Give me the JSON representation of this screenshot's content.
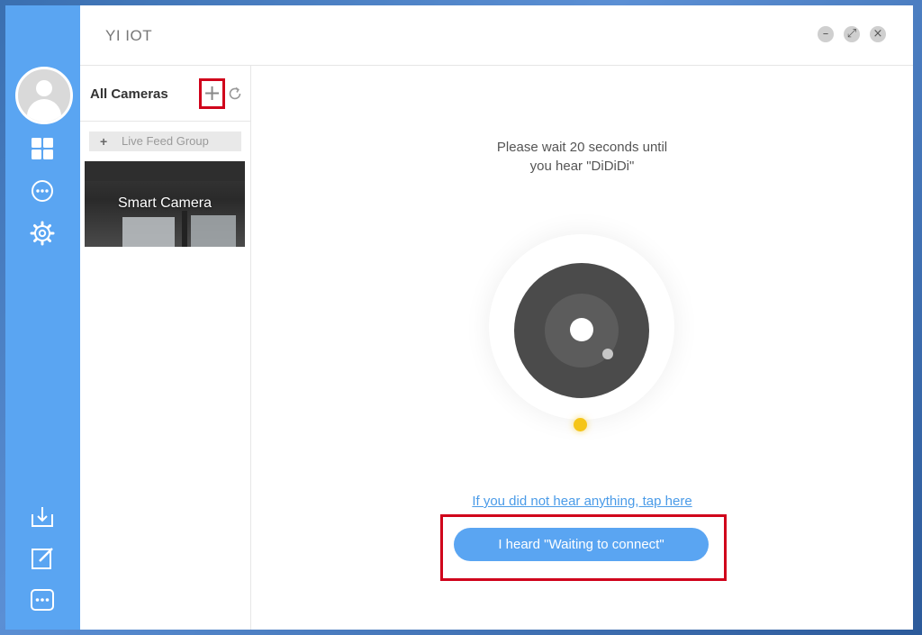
{
  "app": {
    "title": "YI IOT"
  },
  "window_controls": {
    "minimize": "–",
    "restore": "⤢",
    "close": "×"
  },
  "nav_rail": {
    "top_items": [
      {
        "name": "dashboard",
        "icon": "grid-icon"
      },
      {
        "name": "messages",
        "icon": "chat-bubble-icon"
      },
      {
        "name": "settings",
        "icon": "gear-icon"
      }
    ],
    "bottom_items": [
      {
        "name": "download",
        "icon": "download-icon"
      },
      {
        "name": "feedback",
        "icon": "edit-icon"
      },
      {
        "name": "more",
        "icon": "more-icon"
      }
    ],
    "accent": "#5aa5f2"
  },
  "cameras_panel": {
    "title": "All Cameras",
    "add_label": "+",
    "group_button": {
      "plus": "+",
      "label": "Live Feed Group"
    },
    "cameras": [
      {
        "name": "Smart Camera"
      }
    ]
  },
  "main": {
    "instruction_line1": "Please wait 20 seconds until",
    "instruction_line2": "you hear \"DiDiDi\"",
    "help_link": "If you did not hear anything, tap here",
    "confirm_button": "I heard \"Waiting to connect\"",
    "indicator_color": "#f5c518"
  },
  "highlight_color": "#d0021b"
}
